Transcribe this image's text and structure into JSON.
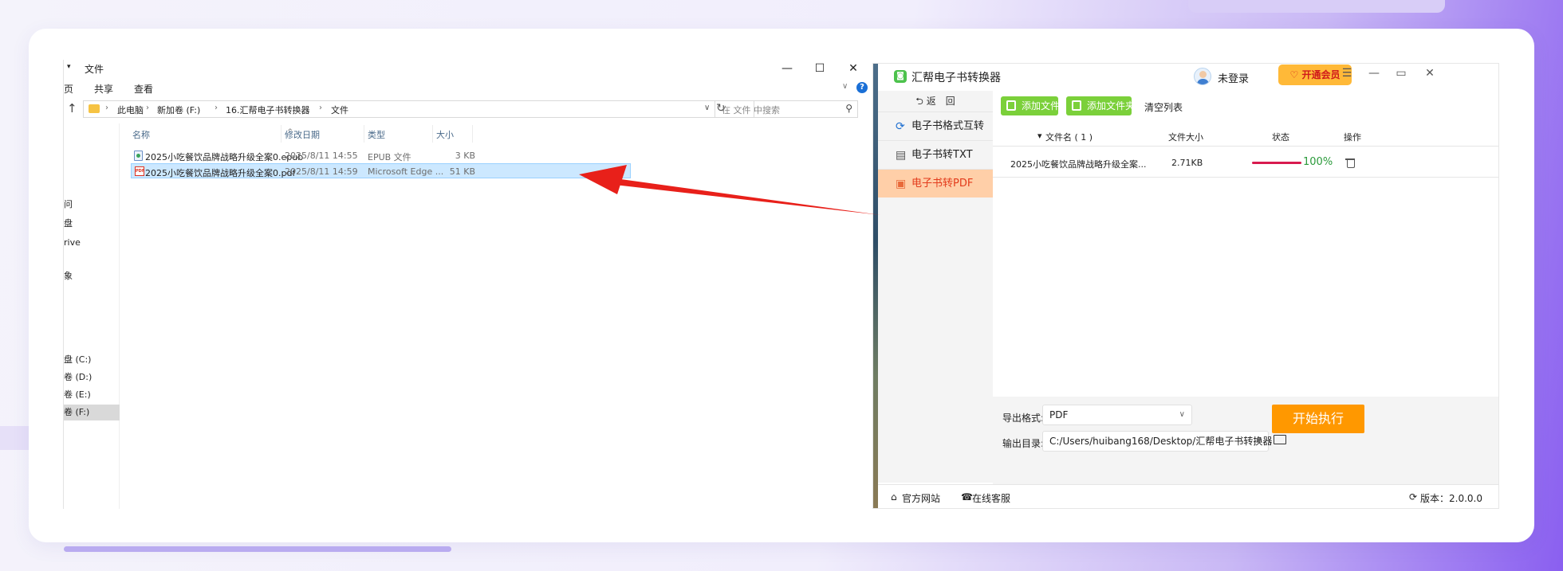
{
  "explorer": {
    "title": "文件",
    "qa_symbol": "▾",
    "ribbon": [
      "页",
      "共享",
      "查看"
    ],
    "breadcrumb": [
      "此电脑",
      "新加卷 (F:)",
      "16.汇帮电子书转换器",
      "文件"
    ],
    "search_placeholder": "在 文件 中搜索",
    "sidebar_top": [
      "问",
      "盘",
      "rive",
      "",
      "象"
    ],
    "drives": [
      "盘 (C:)",
      "卷 (D:)",
      "卷 (E:)",
      "卷 (F:)"
    ],
    "columns": [
      "名称",
      "修改日期",
      "类型",
      "大小"
    ],
    "files": [
      {
        "name": "2025小吃餐饮品牌战略升级全案0.epub",
        "date": "2025/8/11 14:55",
        "type": "EPUB 文件",
        "size": "3 KB"
      },
      {
        "name": "2025小吃餐饮品牌战略升级全案0.pdf",
        "date": "2025/8/11 14:59",
        "type": "Microsoft Edge ...",
        "size": "51 KB"
      }
    ]
  },
  "app": {
    "name": "汇帮电子书转换器",
    "login": "未登录",
    "vip": "开通会员",
    "back": "返　回",
    "nav": [
      "电子书格式互转",
      "电子书转TXT",
      "电子书转PDF"
    ],
    "add_file": "添加文件",
    "add_folder": "添加文件夹",
    "clear_list": "清空列表",
    "table_headers": [
      "文件名 ( 1 )",
      "文件大小",
      "状态",
      "操作"
    ],
    "rows": [
      {
        "name": "2025小吃餐饮品牌战略升级全案...",
        "size": "2.71KB",
        "status": "100%",
        "progress": 1.0
      }
    ],
    "export_format_label": "导出格式:",
    "export_format": "PDF",
    "output_dir_label": "输出目录:",
    "output_dir": "C:/Users/huibang168/Desktop/汇帮电子书转换器",
    "start": "开始执行",
    "footer": {
      "website": "官方网站",
      "service": "在线客服",
      "version": "版本：2.0.0.0"
    }
  },
  "colors": {
    "accent_green": "#7bd03a",
    "start_orange": "#ff9800",
    "vip_yellow": "#ffb938",
    "active_nav": "#ffcfa8",
    "arrow_red": "#e8201a"
  }
}
